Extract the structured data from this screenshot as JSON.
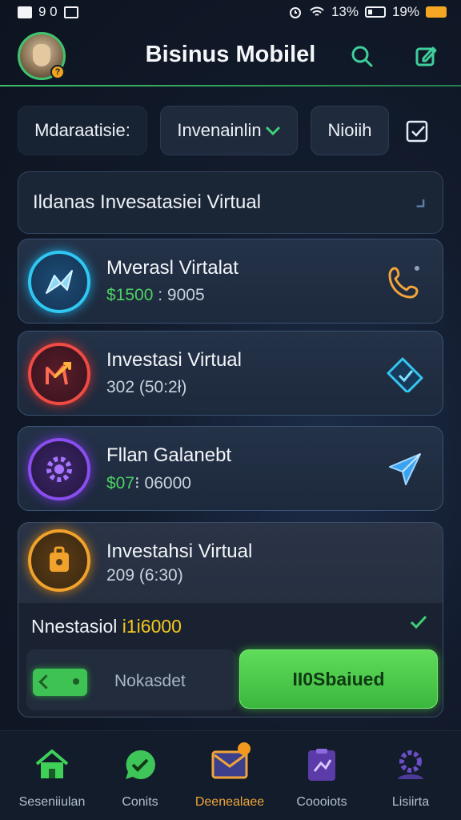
{
  "status_bar": {
    "left_text": "9 0",
    "battery_a": "13%",
    "battery_b": "19%"
  },
  "header": {
    "title": "Bisinus Mobilel",
    "avatar_badge": "?"
  },
  "filters": {
    "label": "Mdaraatisie:",
    "dropdown": "Invenainlin",
    "chip": "Nioiih"
  },
  "banner": {
    "text": "Ildanas Invesatasiei Virtual"
  },
  "cards": [
    {
      "title": "Mverasl Virtalat",
      "value_highlight": "$1500",
      "value_rest": " : 9005",
      "icon": "send-plane-icon",
      "action_icon": "phone-icon",
      "accent": "#2fc8f2"
    },
    {
      "title": "Investasi Virtual",
      "value_highlight": "",
      "value_rest": "302 (50:2ł)",
      "icon": "chart-arrow-icon",
      "action_icon": "ticket-check-icon",
      "accent": "#ef4b44"
    },
    {
      "title": "Fllan Galanebt",
      "value_highlight": "$07",
      "value_rest": "⁝ 06000",
      "icon": "gear-icon",
      "action_icon": "paper-plane-icon",
      "accent": "#8a4ef0"
    }
  ],
  "expanded_card": {
    "title": "Investahsi Virtual",
    "value": "209 (6:30)",
    "row_label": "Nnestasiol ",
    "row_amount": "i1i6000",
    "wallet_label": "Nokasdet",
    "button_label": "II0Sbaiued",
    "accent": "#f0a22c"
  },
  "bottom_nav": [
    {
      "label": "Seseniiulan",
      "icon": "home-icon"
    },
    {
      "label": "Conits",
      "icon": "check-chat-icon"
    },
    {
      "label": "Deenealaee",
      "icon": "mail-icon"
    },
    {
      "label": "Coooiots",
      "icon": "document-icon"
    },
    {
      "label": "Lisiirta",
      "icon": "profile-icon"
    }
  ]
}
